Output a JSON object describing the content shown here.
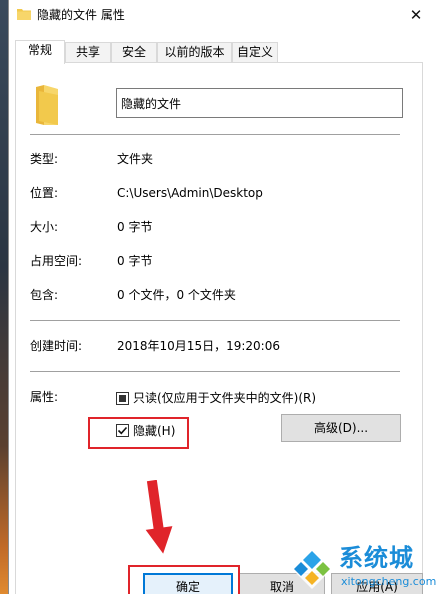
{
  "window": {
    "title": "隐藏的文件 属性",
    "close_glyph": "✕"
  },
  "tabs": [
    {
      "label": "常规"
    },
    {
      "label": "共享"
    },
    {
      "label": "安全"
    },
    {
      "label": "以前的版本"
    },
    {
      "label": "自定义"
    }
  ],
  "general": {
    "name_value": "隐藏的文件",
    "rows": {
      "type": {
        "label": "类型:",
        "value": "文件夹"
      },
      "location": {
        "label": "位置:",
        "value": "C:\\Users\\Admin\\Desktop"
      },
      "size": {
        "label": "大小:",
        "value": "0 字节"
      },
      "disk": {
        "label": "占用空间:",
        "value": "0 字节"
      },
      "contains": {
        "label": "包含:",
        "value": "0 个文件，0 个文件夹"
      },
      "created": {
        "label": "创建时间:",
        "value": "2018年10月15日，19:20:06"
      }
    },
    "attributes": {
      "label": "属性:",
      "readonly_label": "只读(仅应用于文件夹中的文件)(R)",
      "hidden_label": "隐藏(H)",
      "advanced_label": "高级(D)..."
    }
  },
  "buttons": {
    "ok": "确定",
    "cancel": "取消",
    "apply": "应用(A)"
  },
  "watermark": {
    "brand": "系统城",
    "url": "xitongcheng.com"
  },
  "colors": {
    "highlight": "#e0242a",
    "folder": "#f2c94c",
    "accent": "#0078d7",
    "watermark": "#1a8cd8"
  }
}
